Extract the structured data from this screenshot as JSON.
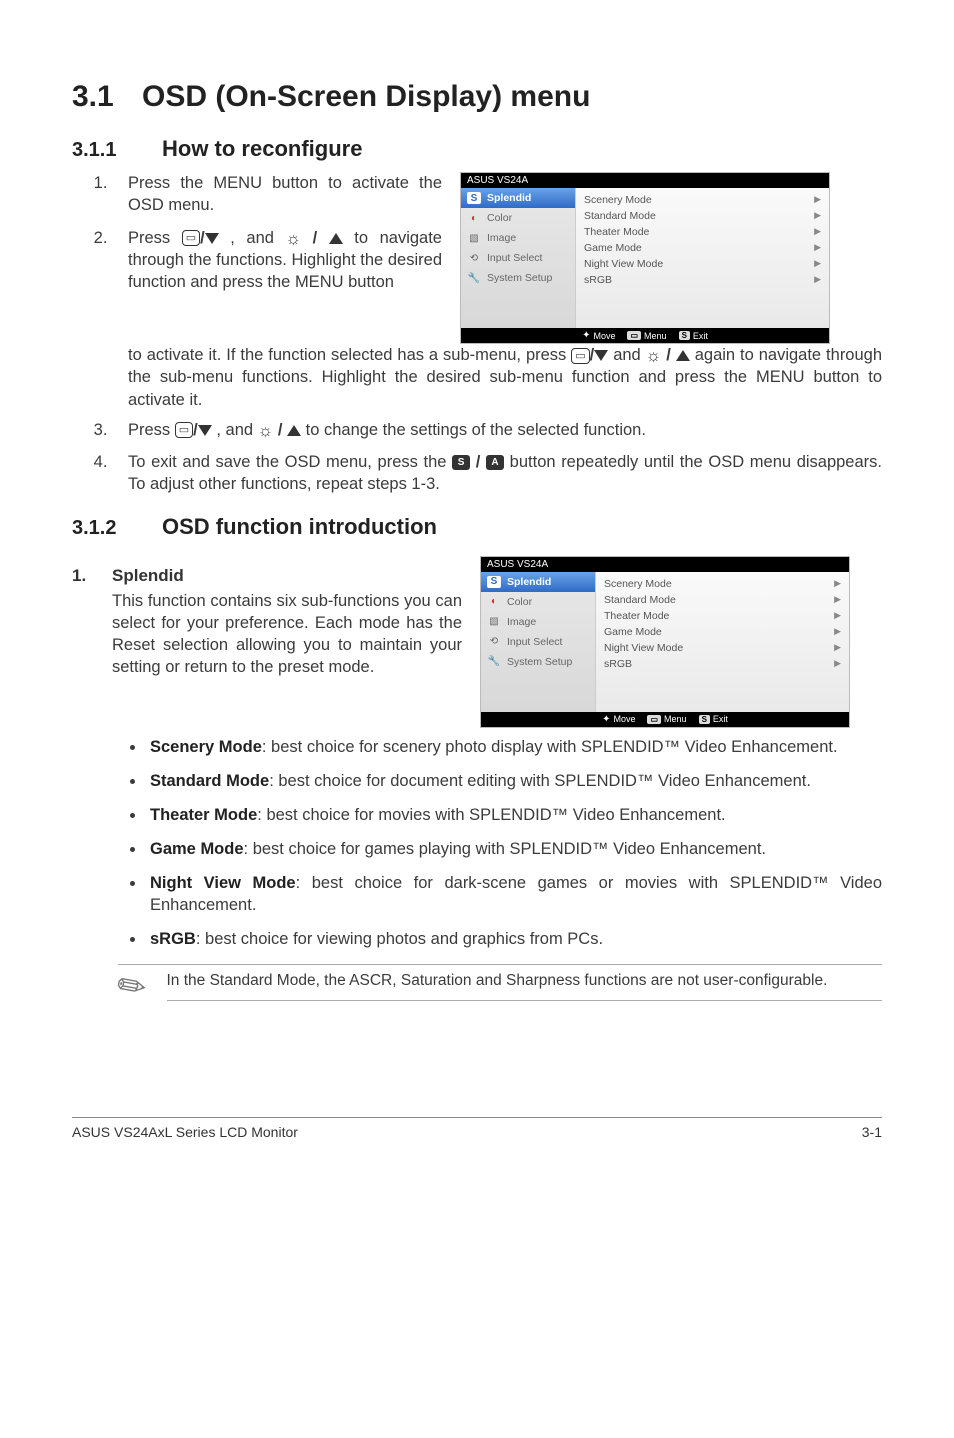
{
  "title": {
    "num": "3.1",
    "text": "OSD (On-Screen Display) menu"
  },
  "sec311": {
    "num": "3.1.1",
    "text": "How to reconfigure"
  },
  "steps": {
    "s1": "Press the MENU button to activate the OSD menu.",
    "s2a": "Press ",
    "s2b": ", and ",
    "s2c": "to navigate through the functions. Highlight the desired function and press the MENU button to activate it. If the function selected has a sub-menu, press ",
    "s2d": " and ",
    "s2e": " again to navigate through the sub-menu functions. Highlight the desired sub-menu function and press the MENU button to activate it.",
    "s3a": "Press ",
    "s3b": ", and ",
    "s3c": "to change the settings of the selected function.",
    "s4a": "To exit and save the OSD menu, press the ",
    "s4b": " button repeatedly until the OSD menu disappears. To adjust other functions, repeat steps 1-3."
  },
  "sec312": {
    "num": "3.1.2",
    "text": "OSD function introduction"
  },
  "splendid": {
    "num": "1.",
    "label": "Splendid",
    "desc": "This function contains six sub-functions you can select for your preference. Each mode has the Reset selection allowing you to maintain your setting or return to the preset mode."
  },
  "osd": {
    "title": "ASUS VS24A",
    "side": {
      "splendid": "Splendid",
      "color": "Color",
      "image": "Image",
      "input": "Input Select",
      "system": "System Setup"
    },
    "opts": {
      "scenery": "Scenery Mode",
      "standard": "Standard Mode",
      "theater": "Theater Mode",
      "game": "Game Mode",
      "night": "Night View Mode",
      "srgb": "sRGB"
    },
    "foot": {
      "move": "Move",
      "menu": "Menu",
      "exit": "Exit"
    }
  },
  "modes": {
    "scenery": {
      "name": "Scenery Mode",
      "desc": ": best choice for scenery photo display with SPLENDID™ Video Enhancement."
    },
    "standard": {
      "name": "Standard Mode",
      "desc": ": best choice for document editing with SPLENDID™ Video Enhancement."
    },
    "theater": {
      "name": "Theater Mode",
      "desc": ": best choice for movies with SPLENDID™ Video Enhancement."
    },
    "game": {
      "name": "Game Mode",
      "desc": ": best choice for games playing with SPLENDID™ Video Enhancement."
    },
    "night": {
      "name": "Night View Mode",
      "desc": ": best choice for dark-scene games or movies with SPLENDID™ Video Enhancement."
    },
    "srgb": {
      "name": "sRGB",
      "desc": ": best choice for viewing photos and graphics from PCs."
    }
  },
  "note": "In the Standard Mode, the ASCR, Saturation and Sharpness functions are not user-configurable.",
  "footer": {
    "left": "ASUS VS24AxL Series LCD Monitor",
    "right": "3-1"
  }
}
